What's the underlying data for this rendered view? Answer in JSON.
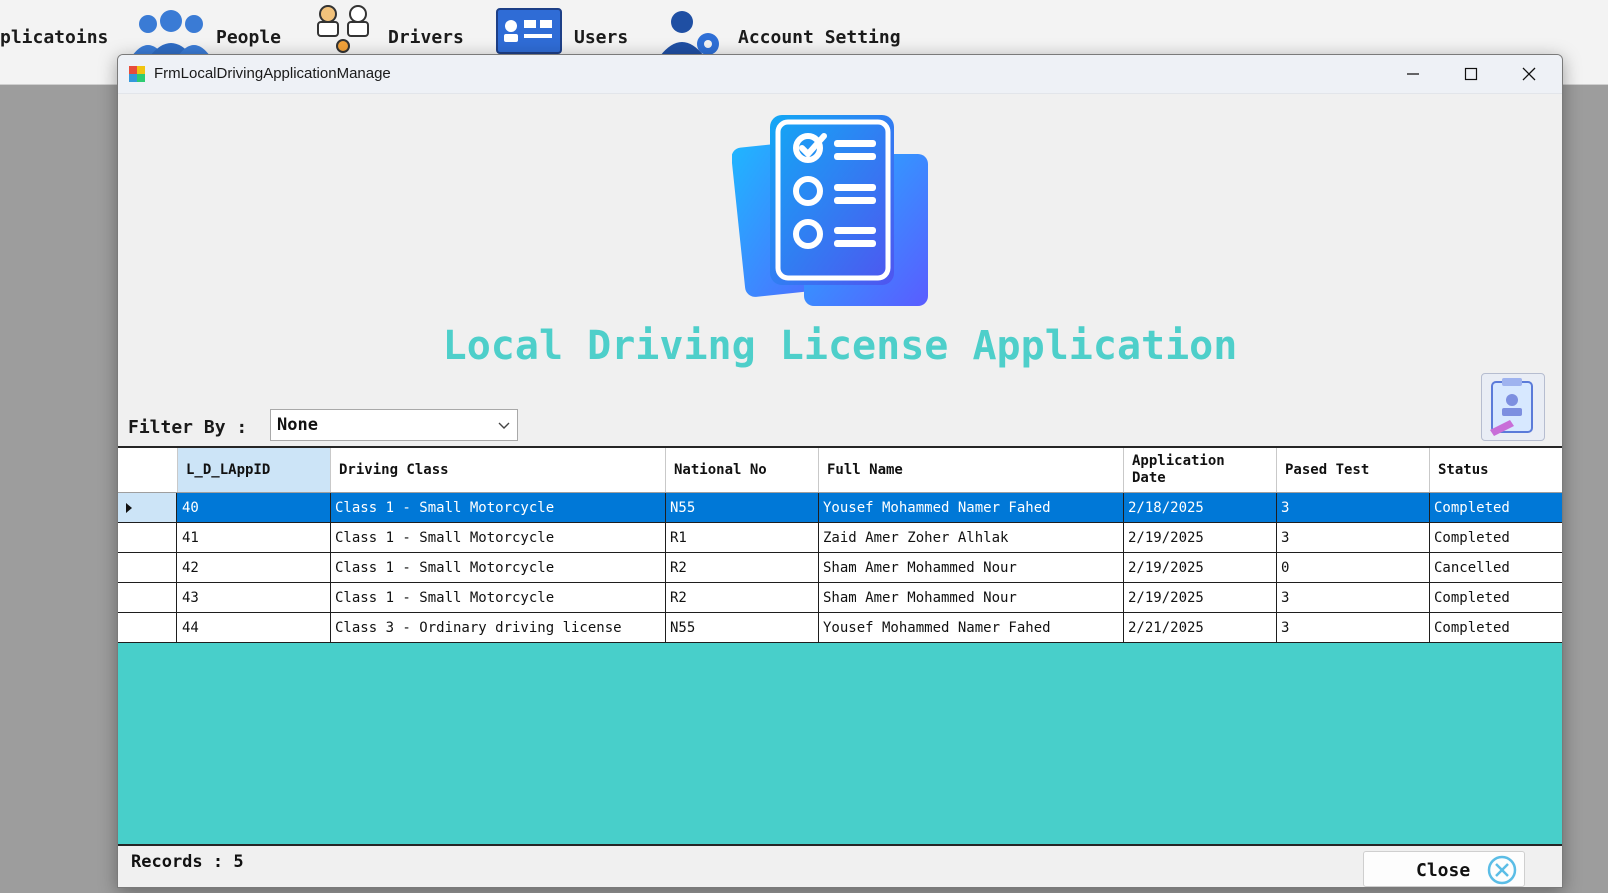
{
  "menubar": {
    "items": [
      {
        "label": "plicatoins",
        "icon": "applications-icon"
      },
      {
        "label": "People",
        "icon": "people-icon"
      },
      {
        "label": "Drivers",
        "icon": "drivers-icon"
      },
      {
        "label": "Users",
        "icon": "users-card-icon"
      },
      {
        "label": "Account Setting",
        "icon": "account-settings-icon"
      }
    ]
  },
  "window": {
    "title": "FrmLocalDrivingApplicationManage",
    "heading": "Local Driving License Application",
    "filter": {
      "label": "Filter By :",
      "selected": "None"
    },
    "grid": {
      "columns": [
        "L_D_LAppID",
        "Driving Class",
        "National No",
        "Full Name",
        "Application Date",
        "Pased Test",
        "Status"
      ],
      "rows": [
        [
          "40",
          "Class 1 - Small Motorcycle",
          "N55",
          "Yousef Mohammed Namer Fahed",
          "2/18/2025",
          "3",
          "Completed"
        ],
        [
          "41",
          "Class 1 - Small Motorcycle",
          "R1",
          "Zaid Amer Zoher Alhlak",
          "2/19/2025",
          "3",
          "Completed"
        ],
        [
          "42",
          "Class 1 - Small Motorcycle",
          "R2",
          "Sham Amer Mohammed Nour",
          "2/19/2025",
          "0",
          "Cancelled"
        ],
        [
          "43",
          "Class 1 - Small Motorcycle",
          "R2",
          "Sham Amer Mohammed Nour",
          "2/19/2025",
          "3",
          "Completed"
        ],
        [
          "44",
          "Class 3 - Ordinary driving license",
          "N55",
          "Yousef Mohammed Namer Fahed",
          "2/21/2025",
          "3",
          "Completed"
        ]
      ],
      "selected_row": 0
    },
    "footer": {
      "records_label": "Records : 5",
      "close_label": "Close"
    }
  },
  "colors": {
    "accent": "#4ecfca",
    "selection": "#0078d7",
    "grid_bg": "#48cfca"
  }
}
